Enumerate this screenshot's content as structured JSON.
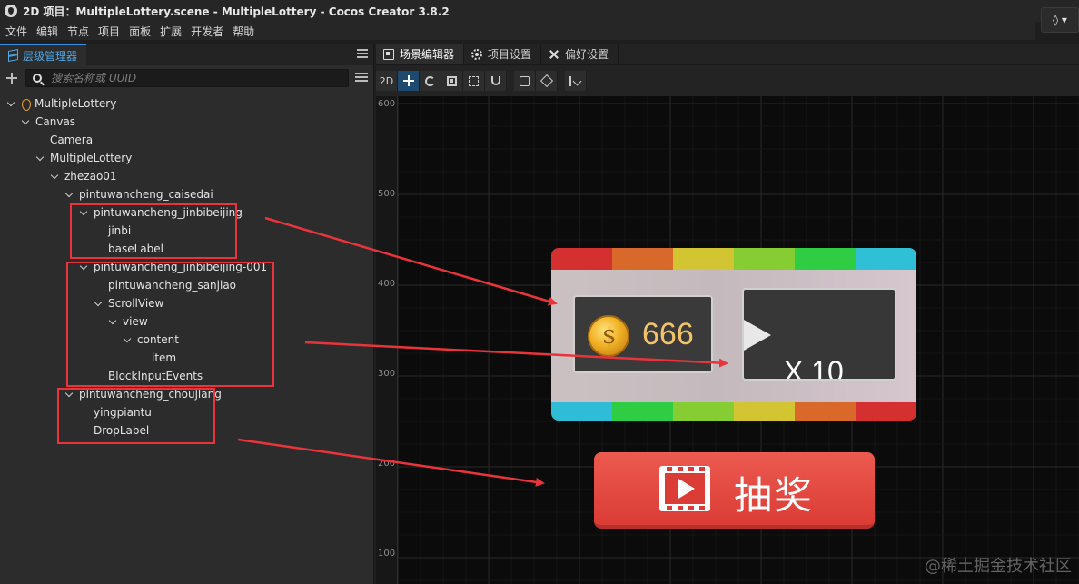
{
  "window": {
    "title": "2D 项目：MultipleLottery.scene - MultipleLottery - Cocos Creator 3.8.2"
  },
  "menubar": {
    "items": [
      "文件",
      "编辑",
      "节点",
      "项目",
      "面板",
      "扩展",
      "开发者",
      "帮助"
    ]
  },
  "hierarchy": {
    "tab_label": "层级管理器",
    "search_placeholder": "搜索名称或 UUID",
    "nodes": [
      {
        "label": "MultipleLottery",
        "depth": 0,
        "caret": true,
        "icon": "scene-icon"
      },
      {
        "label": "Canvas",
        "depth": 1,
        "caret": true
      },
      {
        "label": "Camera",
        "depth": 2,
        "caret": false
      },
      {
        "label": "MultipleLottery",
        "depth": 2,
        "caret": true
      },
      {
        "label": "zhezao01",
        "depth": 3,
        "caret": true
      },
      {
        "label": "pintuwancheng_caisedai",
        "depth": 4,
        "caret": true
      },
      {
        "label": "pintuwancheng_jinbibeijing",
        "depth": 5,
        "caret": true
      },
      {
        "label": "jinbi",
        "depth": 6,
        "caret": false
      },
      {
        "label": "baseLabel",
        "depth": 6,
        "caret": false
      },
      {
        "label": "pintuwancheng_jinbibeijing-001",
        "depth": 5,
        "caret": true
      },
      {
        "label": "pintuwancheng_sanjiao",
        "depth": 6,
        "caret": false
      },
      {
        "label": "ScrollView",
        "depth": 6,
        "caret": true
      },
      {
        "label": "view",
        "depth": 7,
        "caret": true
      },
      {
        "label": "content",
        "depth": 8,
        "caret": true
      },
      {
        "label": "item",
        "depth": 9,
        "caret": false
      },
      {
        "label": "BlockInputEvents",
        "depth": 6,
        "caret": false
      },
      {
        "label": "pintuwancheng_choujiang",
        "depth": 4,
        "caret": true
      },
      {
        "label": "yingpiantu",
        "depth": 5,
        "caret": false
      },
      {
        "label": "DropLabel",
        "depth": 5,
        "caret": false
      }
    ]
  },
  "scene_tabs": [
    {
      "label": "场景编辑器",
      "icon": "scene-tab-icon",
      "active": true
    },
    {
      "label": "项目设置",
      "icon": "gear-icon",
      "active": false
    },
    {
      "label": "偏好设置",
      "icon": "tools-icon",
      "active": false
    }
  ],
  "scene_toolbar": {
    "mode_label": "2D"
  },
  "ruler": {
    "labels": [
      "600",
      "500",
      "400",
      "300",
      "200",
      "100"
    ]
  },
  "game": {
    "coin_count": "666",
    "multiplier": "X 10",
    "draw_button_label": "抽奖",
    "stripe_top_colors": [
      "#d3302f",
      "#d9682b",
      "#d2c531",
      "#85cd32",
      "#2fcd43",
      "#2fc0d6"
    ],
    "stripe_bottom_colors": [
      "#2fbcd6",
      "#2fcd43",
      "#85cd32",
      "#d2c531",
      "#d9682b",
      "#d3302f"
    ]
  },
  "annotation_color": "#e8343a",
  "watermark": "@稀土掘金技术社区"
}
